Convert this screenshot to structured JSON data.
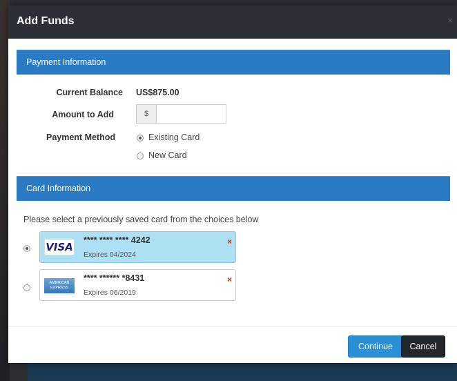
{
  "modal": {
    "title": "Add Funds",
    "close_label": "×"
  },
  "payment_info": {
    "section_title": "Payment Information",
    "current_balance_label": "Current Balance",
    "current_balance_value": "US$875.00",
    "amount_label": "Amount to Add",
    "currency_symbol": "$",
    "amount_value": "",
    "payment_method_label": "Payment Method",
    "methods": [
      {
        "label": "Existing Card",
        "checked": true
      },
      {
        "label": "New Card",
        "checked": false
      }
    ]
  },
  "card_info": {
    "section_title": "Card Information",
    "helper_text": "Please select a previously saved card from the choices below",
    "cards": [
      {
        "brand": "VISA",
        "icon": "visa-logo-icon",
        "number": "**** **** **** 4242",
        "expiry": "Expires 04/2024",
        "selected": true,
        "delete_label": "×"
      },
      {
        "brand": "American Express",
        "icon": "amex-logo-icon",
        "brand_line1": "AMERICAN",
        "brand_line2": "EXPRESS",
        "number": "**** ****** *8431",
        "expiry": "Expires 06/2019",
        "selected": false,
        "delete_label": "×"
      }
    ]
  },
  "footer": {
    "continue_label": "Continue",
    "cancel_label": "Cancel"
  },
  "colors": {
    "header_bg": "#2a3035",
    "section_bar": "#2b7bc4",
    "selected_card": "#aee0f3",
    "primary_button": "#2b8fd6",
    "cancel_button": "#22272b",
    "delete_red": "#d9261c"
  }
}
